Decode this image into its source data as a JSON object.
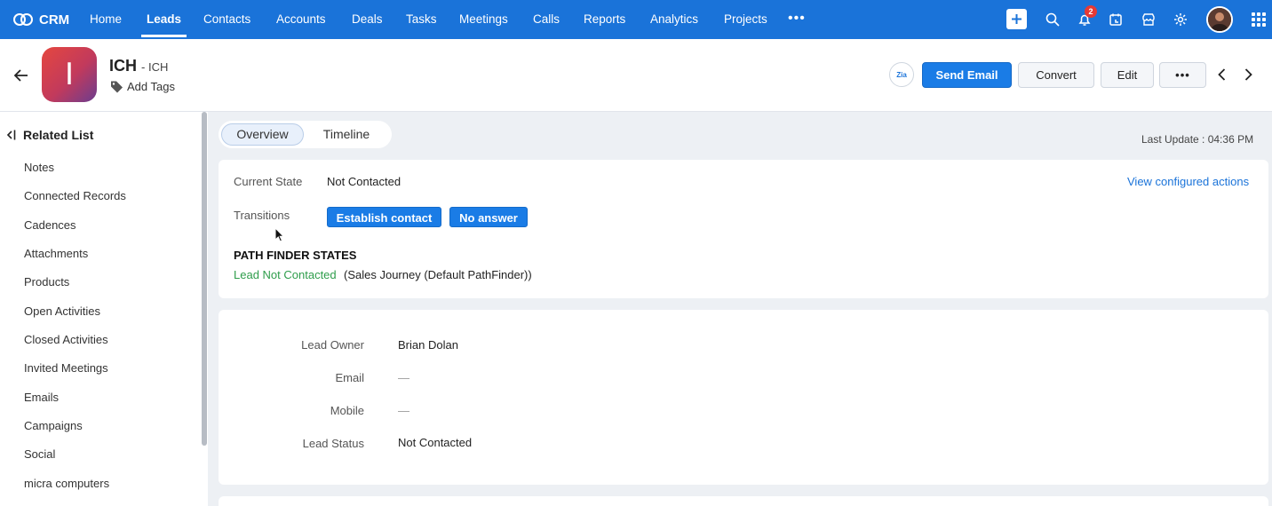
{
  "nav": {
    "brand": "CRM",
    "items": [
      "Home",
      "Leads",
      "Contacts",
      "Accounts",
      "Deals",
      "Tasks",
      "Meetings",
      "Calls",
      "Reports",
      "Analytics",
      "Projects"
    ],
    "active": "Leads",
    "more": "•••",
    "notification_count": "2"
  },
  "record": {
    "avatar_letter": "I",
    "name": "ICH",
    "subtitle": "- ICH",
    "add_tags": "Add Tags",
    "zia_label": "Zia",
    "buttons": {
      "send_email": "Send Email",
      "convert": "Convert",
      "edit": "Edit",
      "more": "•••"
    }
  },
  "sidebar": {
    "title": "Related List",
    "items": [
      "Notes",
      "Connected Records",
      "Cadences",
      "Attachments",
      "Products",
      "Open Activities",
      "Closed Activities",
      "Invited Meetings",
      "Emails",
      "Campaigns",
      "Social",
      "micra computers"
    ]
  },
  "tabs": {
    "overview": "Overview",
    "timeline": "Timeline",
    "last_update": "Last Update : 04:36 PM"
  },
  "blueprint": {
    "current_state_label": "Current State",
    "current_state_value": "Not Contacted",
    "view_actions": "View configured actions",
    "transitions_label": "Transitions",
    "transitions": [
      "Establish contact",
      "No answer"
    ],
    "pathfinder_title": "PATH FINDER STATES",
    "pathfinder_state": "Lead Not Contacted",
    "pathfinder_journey": "(Sales Journey (Default PathFinder))"
  },
  "details": {
    "fields": [
      {
        "label": "Lead Owner",
        "value": "Brian Dolan"
      },
      {
        "label": "Email",
        "value": "—"
      },
      {
        "label": "Mobile",
        "value": "—"
      },
      {
        "label": "Lead Status",
        "value": "Not Contacted"
      }
    ]
  },
  "colors": {
    "nav_bg": "#1a73d9",
    "primary_button": "#1a7ce6",
    "state_green": "#2e9d4b",
    "badge_red": "#e53935"
  }
}
